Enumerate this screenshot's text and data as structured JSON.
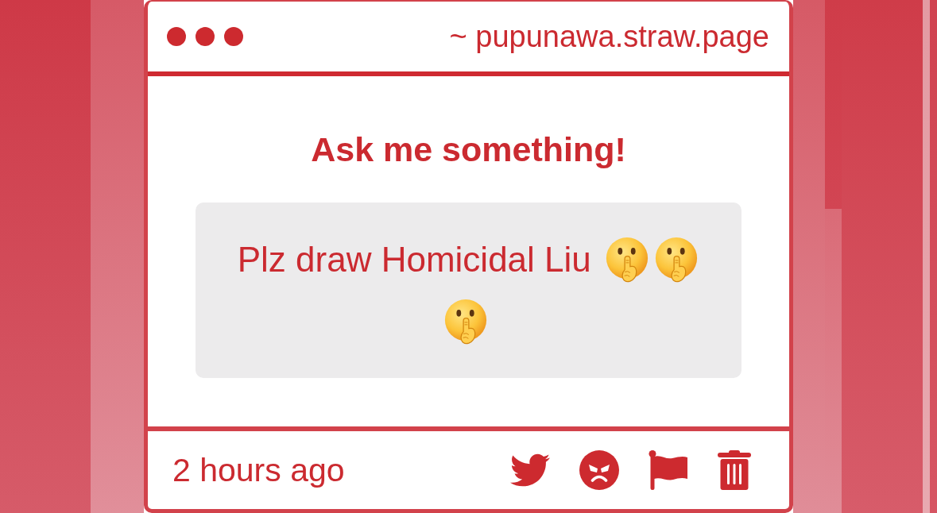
{
  "window": {
    "url": "~ pupunawa.straw.page"
  },
  "prompt": {
    "title": "Ask me something!"
  },
  "question": {
    "text": "Plz draw Homicidal Liu"
  },
  "footer": {
    "time": "2 hours ago"
  }
}
